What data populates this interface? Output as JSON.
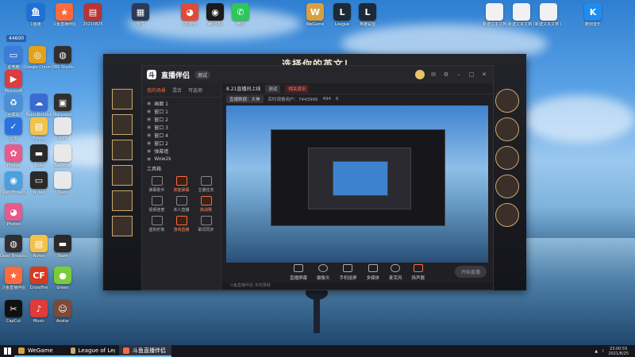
{
  "desktop": {
    "top_icons": [
      {
        "label": "1鱼播",
        "color": "#1e6fd8"
      },
      {
        "label": "斗鱼直播伴侣",
        "color": "#ff6a3c"
      },
      {
        "label": "20210825",
        "color": "#b33"
      },
      {
        "label": "软件",
        "color": "#2b3a55"
      },
      {
        "label": "QQ游戏",
        "color": "#e04a3a"
      },
      {
        "label": "腾讯QQ",
        "color": "#1a1a1a"
      },
      {
        "label": "微信",
        "color": "#2ec65b"
      },
      {
        "label": "WeGame",
        "color": "#d8a040"
      },
      {
        "label": "League",
        "color": "#1d2a36"
      },
      {
        "label": "英雄联盟",
        "color": "#1d2a36"
      },
      {
        "label": "新建文本文档",
        "color": "#f1f1f1"
      },
      {
        "label": "新建文本文档 (2)",
        "color": "#f1f1f1"
      },
      {
        "label": "新建文本文档 (3)",
        "color": "#f1f1f1"
      },
      {
        "label": "酷狗音乐",
        "color": "#1f8bf3"
      }
    ],
    "left_icons": [
      {
        "label": "此电脑",
        "color": "#3b7dd8"
      },
      {
        "label": "Google Chrome",
        "color": "#e3a21a"
      },
      {
        "label": "OBS Studio",
        "color": "#302e31"
      },
      {
        "label": "Microsoft",
        "color": "#d93d3d"
      },
      {
        "label": "回收站",
        "color": "#4a8fd8"
      },
      {
        "label": "BaiduNetdisk",
        "color": "#3a6bd1"
      },
      {
        "label": "Wallpaper",
        "color": "#2f2f2f"
      },
      {
        "label": "迅雷",
        "color": "#2b72e0"
      },
      {
        "label": "Folder",
        "color": "#f3c24a"
      },
      {
        "label": "WPS",
        "color": "#e8e8e8"
      },
      {
        "label": "Photos",
        "color": "#e85a8a"
      },
      {
        "label": "Tools",
        "color": "#2a2a2a"
      },
      {
        "label": "Settings",
        "color": "#e9e9e9"
      },
      {
        "label": "Open Broadcaster",
        "color": "#302e31"
      },
      {
        "label": "Notes",
        "color": "#f3c24a"
      },
      {
        "label": "Team",
        "color": "#2a2a2a"
      },
      {
        "label": "斗鱼直播伴侣",
        "color": "#ff6a3c"
      },
      {
        "label": "CrossFire",
        "color": "#d83a1e"
      },
      {
        "label": "Green",
        "color": "#7acc3a"
      },
      {
        "label": "CapCut",
        "color": "#111111"
      },
      {
        "label": "Music",
        "color": "#e03b3b"
      },
      {
        "label": "Avatar",
        "color": "#7a4a3a"
      }
    ],
    "overlay_badge": "44600"
  },
  "lol": {
    "title": "选择你的英文！"
  },
  "app": {
    "name": "直播伴侣",
    "version": "测试",
    "left_tabs": [
      "我的场景",
      "混合",
      "可选项"
    ],
    "scenes": [
      "画面 1",
      "窗口 1",
      "窗口 2",
      "窗口 3",
      "窗口 4",
      "窗口 2",
      "弹幕墙",
      "Wow2k"
    ],
    "tools_title": "工具箱",
    "tools": [
      {
        "label": "弹幕助手",
        "hot": false
      },
      {
        "label": "高能弹幕",
        "hot": true
      },
      {
        "label": "主播任务",
        "hot": false
      },
      {
        "label": "视频连麦",
        "hot": false
      },
      {
        "label": "本人直播",
        "hot": false
      },
      {
        "label": "挑战赛",
        "hot": true
      },
      {
        "label": "虚拟形象",
        "hot": false
      },
      {
        "label": "游戏直播",
        "hot": true
      },
      {
        "label": "歌词同步",
        "hot": false
      }
    ],
    "topbar": {
      "title": "8.21直播间上线",
      "chip1": "测试",
      "chip2": "相关资讯",
      "stats": [
        "直播数据：大神",
        "实时观看用户：7443966",
        "494",
        "6"
      ]
    },
    "bottom": [
      "直播屏幕",
      "摄像头",
      "手机投屏",
      "多媒体",
      "麦克风",
      "扬声器"
    ],
    "live_button": "开始直播",
    "status": "斗鱼直播伴侣 本地录制"
  },
  "taskbar": {
    "items": [
      {
        "label": "WeGame",
        "color": "#d8a040",
        "active": false
      },
      {
        "label": "League of Legends",
        "color": "#c8aa6e",
        "active": false
      },
      {
        "label": "斗鱼直播伴侣",
        "color": "#ff6a3c",
        "active": true
      }
    ],
    "time": "23:00:55",
    "date": "2021/8/25"
  }
}
